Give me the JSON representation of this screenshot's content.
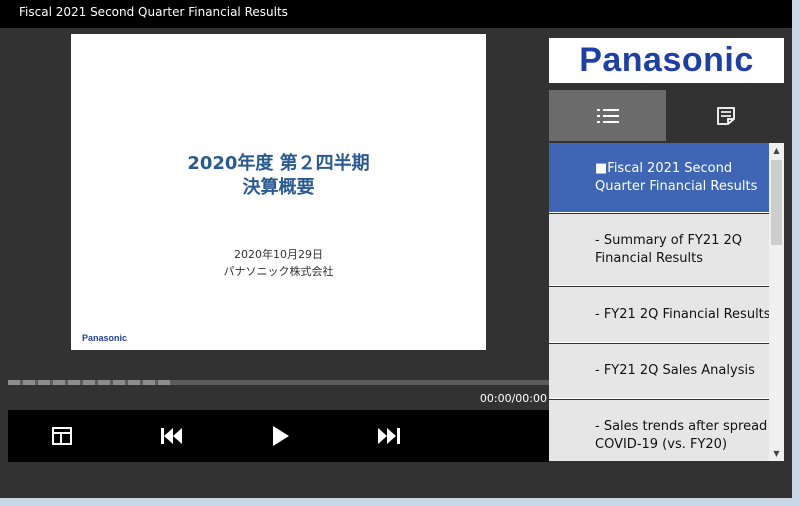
{
  "window": {
    "title": "Fiscal 2021 Second Quarter Financial Results"
  },
  "slide": {
    "title_line1": "2020年度 第２四半期",
    "title_line2": "決算概要",
    "date": "2020年10月29日",
    "company": "パナソニック株式会社",
    "logo_text": "Panasonic"
  },
  "player": {
    "time": "00:00/00:00",
    "progress_fraction": 0.0,
    "controls": [
      "layout-icon",
      "previous-icon",
      "play-icon",
      "next-icon"
    ]
  },
  "brand": {
    "logo_text": "Panasonic",
    "color": "#1f3fa8"
  },
  "tabs": [
    {
      "name": "chapter-list",
      "icon": "list-icon",
      "active": true
    },
    {
      "name": "notes",
      "icon": "notes-icon",
      "active": false
    }
  ],
  "chapters": [
    {
      "line1": "■Fiscal 2021 Second",
      "line2": "Quarter Financial Results",
      "active": true
    },
    {
      "line1": "- Summary of FY21 2Q",
      "line2": "Financial Results",
      "active": false
    },
    {
      "line1": "- FY21 2Q Financial Results",
      "line2": "",
      "active": false
    },
    {
      "line1": "- FY21 2Q Sales Analysis",
      "line2": "",
      "active": false
    },
    {
      "line1": "- Sales trends after spread",
      "line2": "COVID-19 (vs. FY20)",
      "active": false
    }
  ],
  "colors": {
    "accent": "#3f65b5",
    "progress": "#6aa0dd",
    "slide_title": "#2a5a92"
  }
}
